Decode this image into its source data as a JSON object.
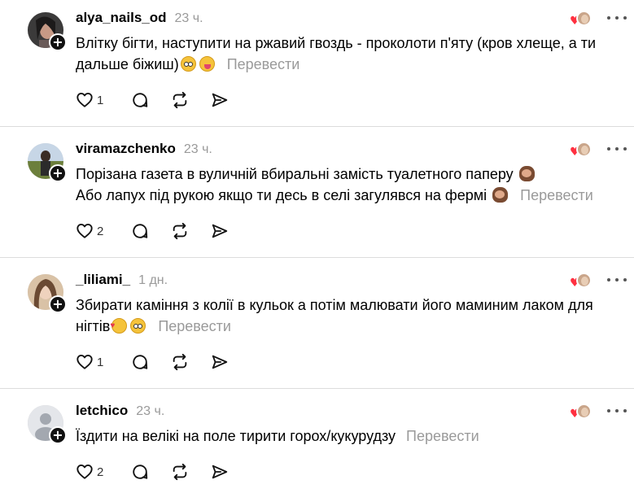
{
  "translate_label": "Перевести",
  "posts": [
    {
      "username": "alya_nails_od",
      "time": "23 ч.",
      "lines": [
        "Влітку бігти, наступити на ржавий гвоздь - проколоти п'яту (кров хлеще, а ти",
        "дальше біжиш)"
      ],
      "likes": "1",
      "emojis": [
        "flushed-emoji",
        "silly-emoji"
      ]
    },
    {
      "username": "viramazchenko",
      "time": "23 ч.",
      "lines": [
        "Порізана газета в вуличній вбиральні замість туалетного паперу",
        "Або лапух під рукою якщо ти десь в селі загулявся на фермі"
      ],
      "likes": "2",
      "emojis": [
        "see-no-evil-monkey-emoji"
      ]
    },
    {
      "username": "_liliami_",
      "time": "1 дн.",
      "lines": [
        "Збирати каміння з колії в кульок а потім малювати його маминим лаком для",
        "нігтів"
      ],
      "likes": "1",
      "emojis": [
        "smiling-hearts-emoji",
        "flushed-emoji"
      ]
    },
    {
      "username": "letchico",
      "time": "23 ч.",
      "lines": [
        "Їздити на велікі на поле тирити горох/кукурудзу"
      ],
      "likes": "2",
      "emojis": []
    }
  ],
  "colors": {
    "muted_text": "#9a9a9a",
    "like_heart": "#ff3040",
    "divider": "#dcdcdc"
  }
}
